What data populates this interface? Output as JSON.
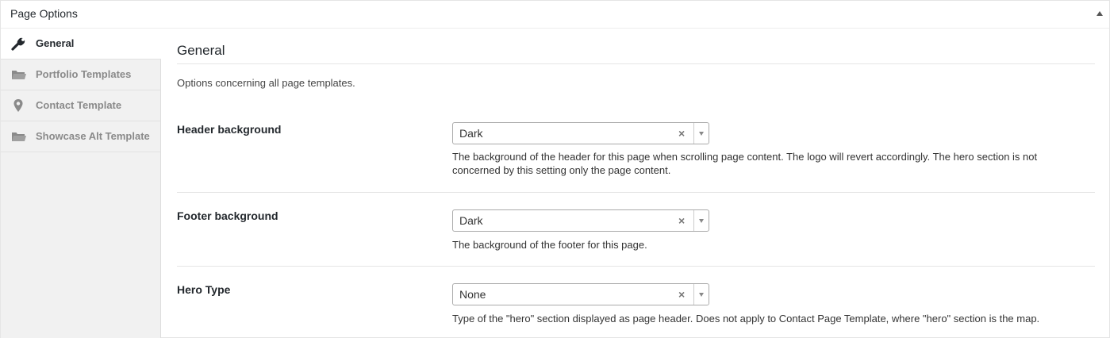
{
  "metabox": {
    "title": "Page Options",
    "toggle_icon": "triangle-up-icon"
  },
  "sidebar": {
    "tabs": [
      {
        "label": "General",
        "icon": "wrench-icon",
        "active": true
      },
      {
        "label": "Portfolio Templates",
        "icon": "folder-icon",
        "active": false
      },
      {
        "label": "Contact Template",
        "icon": "map-pin-icon",
        "active": false
      },
      {
        "label": "Showcase Alt Template",
        "icon": "folder-icon",
        "active": false
      }
    ]
  },
  "section": {
    "title": "General",
    "description": "Options concerning all page templates."
  },
  "fields": [
    {
      "label": "Header background",
      "value": "Dark",
      "clear": "×",
      "description": "The background of the header for this page when scrolling page content. The logo will revert accordingly. The hero section is not concerned by this setting only the page content."
    },
    {
      "label": "Footer background",
      "value": "Dark",
      "clear": "×",
      "description": "The background of the footer for this page."
    },
    {
      "label": "Hero Type",
      "value": "None",
      "clear": "×",
      "description": "Type of the \"hero\" section displayed as page header. Does not apply to Contact Page Template, where \"hero\" section is the map."
    }
  ],
  "colors": {
    "sidebar_bg": "#f1f1f1",
    "active_tab_text": "#23282d",
    "inactive_tab_text": "#8a8a8a"
  }
}
